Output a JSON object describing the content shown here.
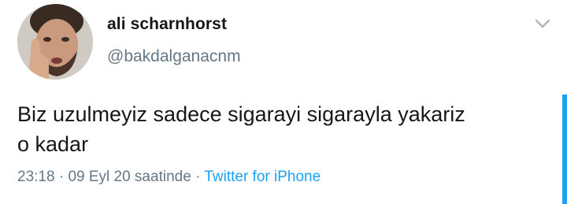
{
  "user": {
    "display_name": "ali scharnhorst",
    "handle": "@bakdalganacnm"
  },
  "tweet": {
    "text_line1": "Biz uzulmeyiz sadece sigarayi sigarayla yakariz",
    "text_line2": "o kadar",
    "time": "23:18",
    "separator": "·",
    "date": "09 Eyl 20 saatinde",
    "source": "Twitter for iPhone"
  },
  "colors": {
    "accent": "#1da1f2",
    "text": "#14171a",
    "muted": "#657786"
  },
  "icons": {
    "menu": "chevron-down-icon"
  }
}
